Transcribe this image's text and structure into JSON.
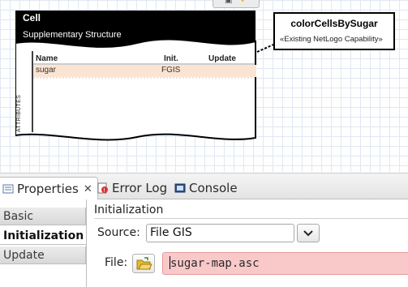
{
  "diagram": {
    "cell": {
      "name": "Cell",
      "stereotype": "Supplementary Structure",
      "columns": [
        "Name",
        "Init.",
        "Update"
      ],
      "section_label": "ATTRIBUTES",
      "attributes": [
        {
          "name": "sugar",
          "init": "FGIS",
          "update": ""
        }
      ]
    },
    "capability": {
      "name": "colorCellsBySugar",
      "stereotype": "«Existing NetLogo Capability»"
    }
  },
  "tabs": [
    {
      "label": "Properties",
      "icon": "properties-icon",
      "active": true,
      "closable": true
    },
    {
      "label": "Error Log",
      "icon": "error-log-icon",
      "active": false,
      "closable": false
    },
    {
      "label": "Console",
      "icon": "console-icon",
      "active": false,
      "closable": false
    }
  ],
  "properties": {
    "sidebar": [
      {
        "label": "Basic",
        "selected": false
      },
      {
        "label": "Initialization",
        "selected": true
      },
      {
        "label": "Update",
        "selected": false
      }
    ],
    "section_title": "Initialization",
    "source": {
      "label": "Source:",
      "value": "File GIS"
    },
    "file": {
      "label": "File:",
      "value": "sugar-map.asc"
    }
  },
  "colors": {
    "header_fill": "#000000",
    "attribute_highlight": "#fce4d2",
    "error_field": "#f9c9c9",
    "grid": "#dfe8f2"
  }
}
